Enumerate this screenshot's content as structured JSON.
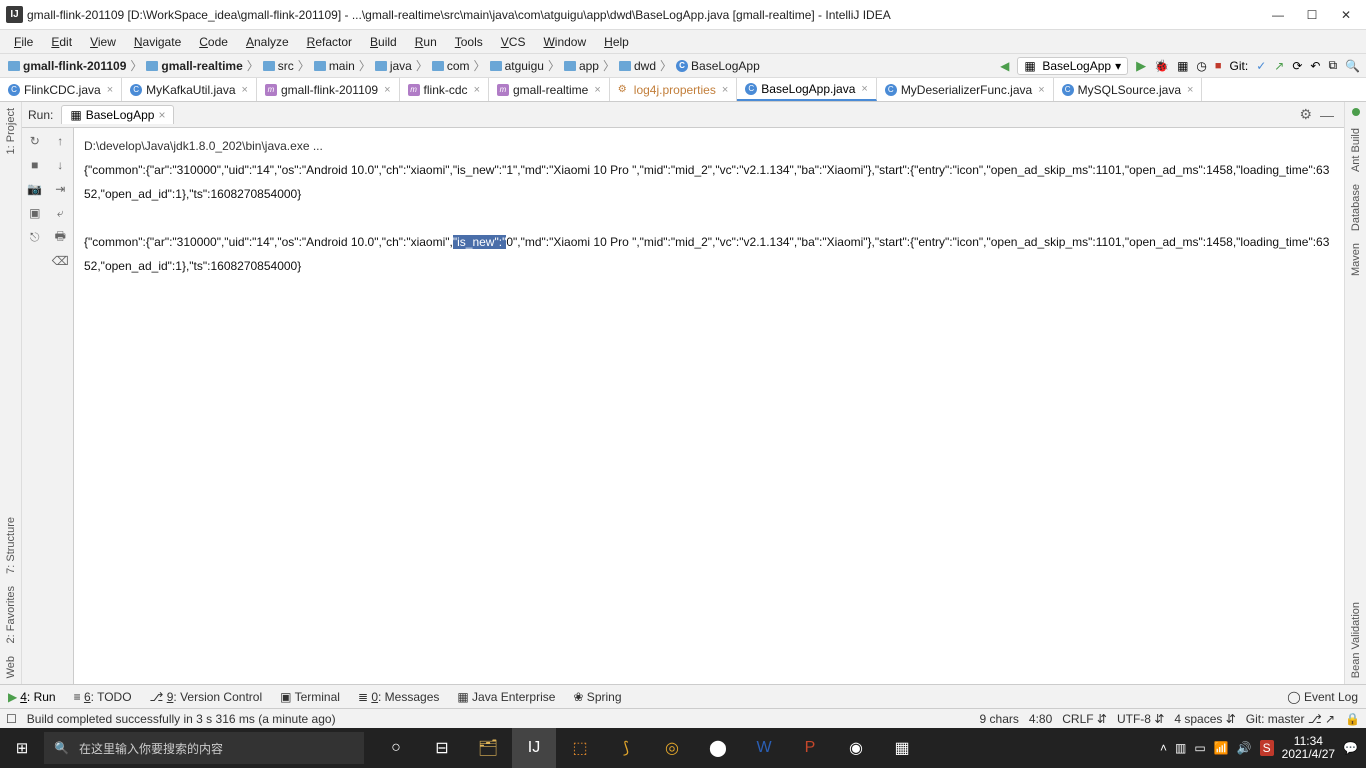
{
  "window": {
    "title": "gmall-flink-201109 [D:\\WorkSpace_idea\\gmall-flink-201109] - ...\\gmall-realtime\\src\\main\\java\\com\\atguigu\\app\\dwd\\BaseLogApp.java [gmall-realtime] - IntelliJ IDEA"
  },
  "menu": [
    "File",
    "Edit",
    "View",
    "Navigate",
    "Code",
    "Analyze",
    "Refactor",
    "Build",
    "Run",
    "Tools",
    "VCS",
    "Window",
    "Help"
  ],
  "breadcrumbs": [
    {
      "label": "gmall-flink-201109",
      "bold": true
    },
    {
      "label": "gmall-realtime",
      "bold": true
    },
    {
      "label": "src"
    },
    {
      "label": "main"
    },
    {
      "label": "java"
    },
    {
      "label": "com"
    },
    {
      "label": "atguigu"
    },
    {
      "label": "app"
    },
    {
      "label": "dwd"
    },
    {
      "label": "BaseLogApp",
      "class": true
    }
  ],
  "run_config": {
    "name": "BaseLogApp"
  },
  "git_label": "Git:",
  "editor_tabs": [
    {
      "label": "FlinkCDC.java",
      "type": "c"
    },
    {
      "label": "MyKafkaUtil.java",
      "type": "c"
    },
    {
      "label": "gmall-flink-201109",
      "type": "m"
    },
    {
      "label": "flink-cdc",
      "type": "m"
    },
    {
      "label": "gmall-realtime",
      "type": "m"
    },
    {
      "label": "log4j.properties",
      "type": "xml",
      "orange": true
    },
    {
      "label": "BaseLogApp.java",
      "type": "c",
      "active": true
    },
    {
      "label": "MyDeserializerFunc.java",
      "type": "c"
    },
    {
      "label": "MySQLSource.java",
      "type": "c"
    }
  ],
  "left_sides": [
    "1: Project",
    "7: Structure",
    "2: Favorites",
    "Web"
  ],
  "right_sides": [
    "Ant Build",
    "Database",
    "Maven",
    "Bean Validation"
  ],
  "run_panel": {
    "label": "Run:",
    "tab": "BaseLogApp"
  },
  "console": {
    "cmd": "D:\\develop\\Java\\jdk1.8.0_202\\bin\\java.exe ...",
    "line1": "{\"common\":{\"ar\":\"310000\",\"uid\":\"14\",\"os\":\"Android 10.0\",\"ch\":\"xiaomi\",\"is_new\":\"1\",\"md\":\"Xiaomi 10 Pro \",\"mid\":\"mid_2\",\"vc\":\"v2.1.134\",\"ba\":\"Xiaomi\"},\"start\":{\"entry\":\"icon\",\"open_ad_skip_ms\":1101,\"open_ad_ms\":1458,\"loading_time\":6352,\"open_ad_id\":1},\"ts\":1608270854000}",
    "line2_pre": "{\"common\":{\"ar\":\"310000\",\"uid\":\"14\",\"os\":\"Android 10.0\",\"ch\":\"xiaomi\",",
    "line2_sel": "\"is_new\":\"",
    "line2_post": "0\",\"md\":\"Xiaomi 10 Pro \",\"mid\":\"mid_2\",\"vc\":\"v2.1.134\",\"ba\":\"Xiaomi\"},\"start\":{\"entry\":\"icon\",\"open_ad_skip_ms\":1101,\"open_ad_ms\":1458,\"loading_time\":6352,\"open_ad_id\":1},\"ts\":1608270854000}"
  },
  "bottom_tools": [
    "4: Run",
    "6: TODO",
    "9: Version Control",
    "Terminal",
    "0: Messages",
    "Java Enterprise",
    "Spring"
  ],
  "event_log": "Event Log",
  "status": {
    "msg": "Build completed successfully in 3 s 316 ms (a minute ago)",
    "sel": "9 chars",
    "pos": "4:80",
    "lf": "CRLF",
    "enc": "UTF-8",
    "indent": "4 spaces",
    "branch": "Git: master"
  },
  "taskbar": {
    "search_ph": "在这里输入你要搜索的内容",
    "time": "11:34",
    "date": "2021/4/27"
  }
}
